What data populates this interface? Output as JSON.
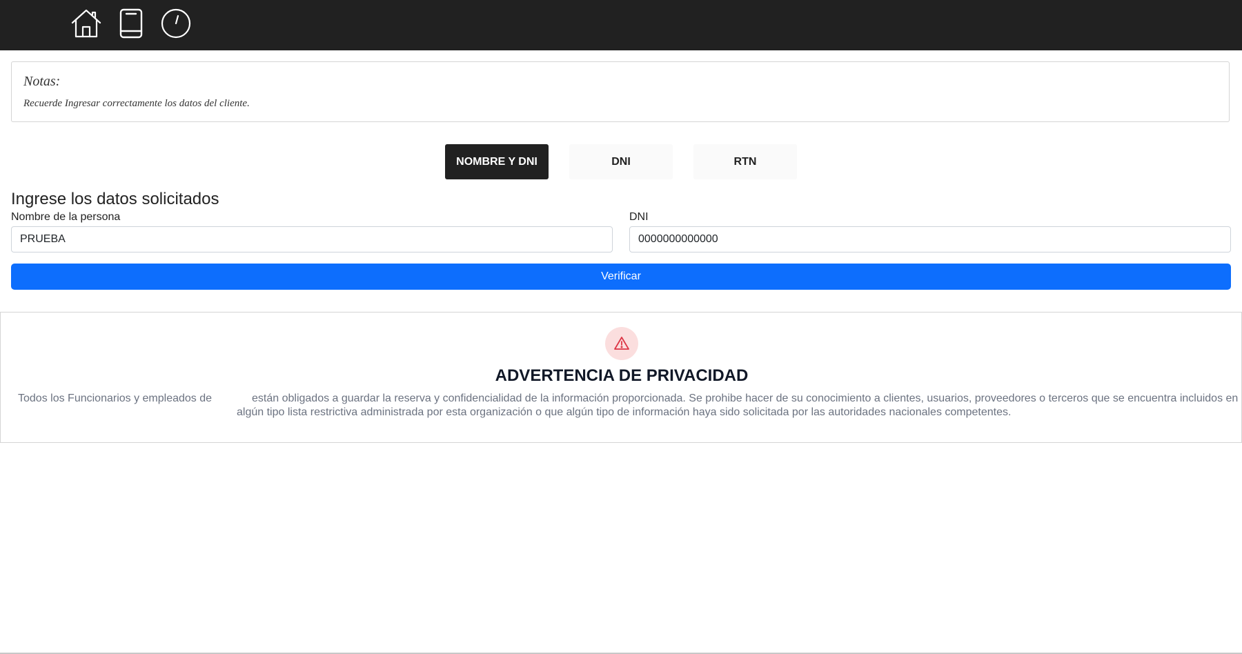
{
  "nav": {
    "icons": [
      "home-icon",
      "book-icon",
      "clock-icon"
    ]
  },
  "notes": {
    "title": "Notas:",
    "text": "Recuerde Ingresar correctamente los datos del cliente."
  },
  "tabs": [
    {
      "label": "NOMBRE Y DNI",
      "active": true
    },
    {
      "label": "DNI",
      "active": false
    },
    {
      "label": "RTN",
      "active": false
    }
  ],
  "form": {
    "title": "Ingrese los datos solicitados",
    "name_label": "Nombre de la persona",
    "name_value": "PRUEBA",
    "dni_label": "DNI",
    "dni_value": "0000000000000",
    "submit_label": "Verificar"
  },
  "privacy": {
    "icon": "warning-icon",
    "title": "ADVERTENCIA DE PRIVACIDAD",
    "text_prefix": "Todos los Funcionarios y empleados de",
    "text_line1": "están obligados a guardar la reserva y confidencialidad de la información proporcionada. Se prohibe hacer de su conocimiento a clientes, usuarios, proveedores o terceros que se encuentra incluidos en",
    "text_line2": "algún tipo lista restrictiva administrada por esta organización o que algún tipo de información haya sido solicitada por las autoridades nacionales competentes."
  },
  "colors": {
    "topbar": "#212121",
    "primary": "#0d6efd",
    "alert_bg": "#fbdede",
    "alert_icon": "#dc3545"
  }
}
